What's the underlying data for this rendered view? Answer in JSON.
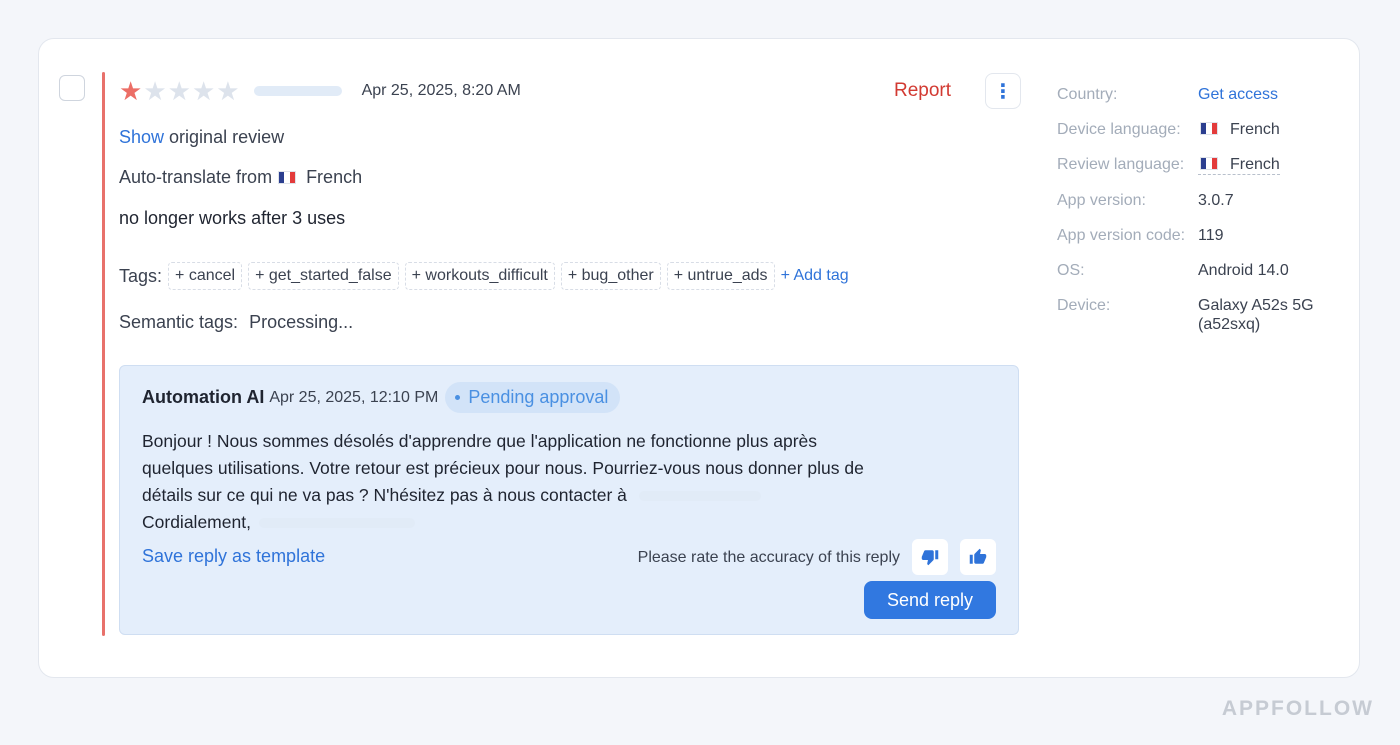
{
  "review": {
    "rating": 1,
    "max_rating": 5,
    "date": "Apr 25, 2025, 8:20 AM",
    "report_label": "Report",
    "more_icon": "⋮",
    "show_link": "Show",
    "show_rest": "original review",
    "autotranslate_label": "Auto-translate from",
    "autotranslate_lang": "French",
    "text": "no longer works after 3 uses",
    "tags_label": "Tags:",
    "tags": [
      "+ cancel",
      "+ get_started_false",
      "+ workouts_difficult",
      "+ bug_other",
      "+ untrue_ads"
    ],
    "add_tag": "+ Add tag",
    "semantic_label": "Semantic tags:",
    "semantic_value": "Processing..."
  },
  "reply": {
    "author": "Automation AI",
    "date": "Apr 25, 2025, 12:10 PM",
    "status": "Pending approval",
    "line1": "Bonjour ! Nous sommes désolés d'apprendre que l'application ne fonctionne plus après",
    "line2": "quelques utilisations. Votre retour est précieux pour nous. Pourriez-vous nous donner plus de",
    "line3": "détails sur ce qui ne va pas ? N'hésitez pas à nous contacter à",
    "line4": "Cordialement,",
    "save_template": "Save reply as template",
    "rate_prompt": "Please rate the accuracy of this reply",
    "send": "Send reply"
  },
  "details": {
    "country_label": "Country:",
    "country_value": "Get access",
    "device_lang_label": "Device language:",
    "device_lang_value": "French",
    "review_lang_label": "Review language:",
    "review_lang_value": "French",
    "app_version_label": "App version:",
    "app_version_value": "3.0.7",
    "app_code_label": "App version code:",
    "app_code_value": "119",
    "os_label": "OS:",
    "os_value": "Android 14.0",
    "device_label": "Device:",
    "device_value": "Galaxy A52s 5G\n(a52sxq)"
  },
  "brand": "APPFOLLOW",
  "colors": {
    "accent": "#2f73d9",
    "report": "#d23a32",
    "star": "#ec6e66",
    "reply_bg": "#e4eefb"
  }
}
